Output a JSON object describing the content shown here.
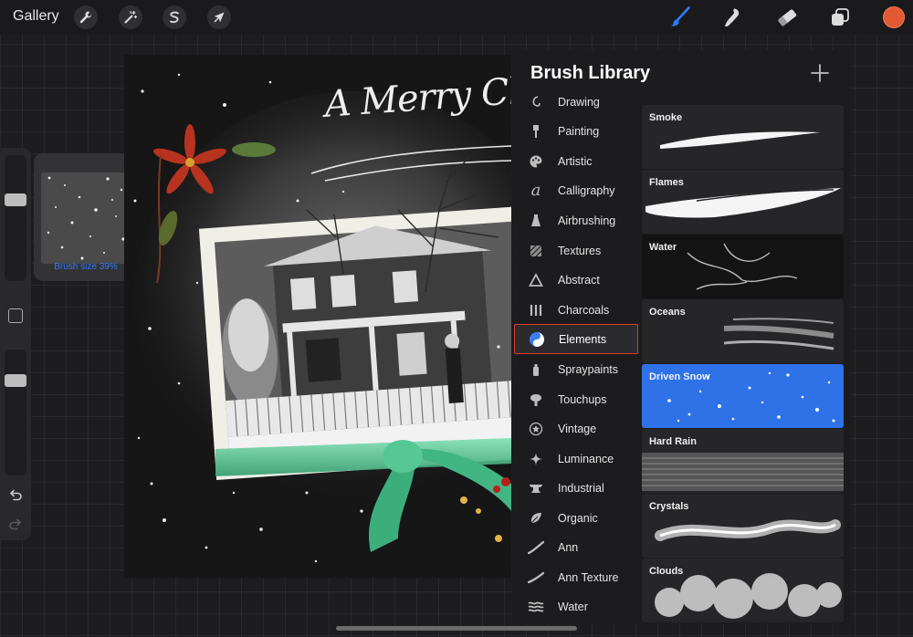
{
  "toolbar": {
    "gallery_label": "Gallery",
    "left_tools": [
      "wrench-icon",
      "magic-wand-icon",
      "selection-icon",
      "transform-arrow-icon"
    ],
    "right_tools": [
      "brush-icon",
      "smudge-icon",
      "eraser-icon",
      "layers-icon"
    ],
    "active_tool": "brush-icon",
    "color": "#e25a33",
    "accent": "#2d7cff"
  },
  "sidebar": {
    "brush_size_label": "Brush size 39%",
    "brush_size": 0.39,
    "opacity": 0.75,
    "undo_icon": "undo-icon",
    "redo_icon": "redo-icon"
  },
  "artwork": {
    "headline": "A Merry Chr"
  },
  "brush_library": {
    "title": "Brush Library",
    "add_icon": "plus-icon",
    "categories": [
      {
        "label": "Drawing",
        "icon": "drawing-icon"
      },
      {
        "label": "Painting",
        "icon": "painting-icon"
      },
      {
        "label": "Artistic",
        "icon": "palette-icon"
      },
      {
        "label": "Calligraphy",
        "icon": "calligraphy-icon"
      },
      {
        "label": "Airbrushing",
        "icon": "airbrush-icon"
      },
      {
        "label": "Textures",
        "icon": "textures-icon"
      },
      {
        "label": "Abstract",
        "icon": "abstract-icon"
      },
      {
        "label": "Charcoals",
        "icon": "charcoal-icon"
      },
      {
        "label": "Elements",
        "icon": "yin-yang-icon",
        "selected": true
      },
      {
        "label": "Spraypaints",
        "icon": "spraypaint-icon"
      },
      {
        "label": "Touchups",
        "icon": "touchup-icon"
      },
      {
        "label": "Vintage",
        "icon": "star-icon"
      },
      {
        "label": "Luminance",
        "icon": "sparkle-icon"
      },
      {
        "label": "Industrial",
        "icon": "anvil-icon"
      },
      {
        "label": "Organic",
        "icon": "leaf-icon"
      },
      {
        "label": "Ann",
        "icon": "stroke-icon"
      },
      {
        "label": "Ann Texture",
        "icon": "stroke-icon"
      },
      {
        "label": "Water",
        "icon": "waves-icon"
      }
    ],
    "brushes": [
      {
        "name": "Smoke"
      },
      {
        "name": "Flames"
      },
      {
        "name": "Water"
      },
      {
        "name": "Oceans"
      },
      {
        "name": "Driven Snow",
        "selected": true
      },
      {
        "name": "Hard Rain"
      },
      {
        "name": "Crystals"
      },
      {
        "name": "Clouds"
      }
    ],
    "selection_color": "#2f72e8",
    "highlight_color": "#e03d2f"
  }
}
